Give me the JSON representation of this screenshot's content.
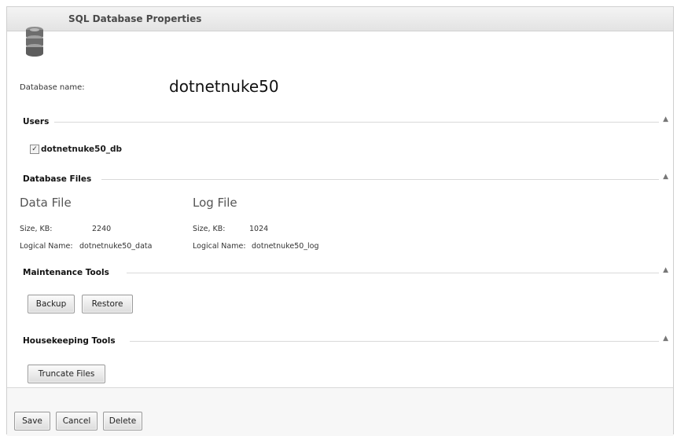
{
  "window": {
    "title": "SQL Database Properties"
  },
  "database": {
    "name_label": "Database name:",
    "name_value": "dotnetnuke50"
  },
  "users": {
    "section_title": "Users",
    "items": [
      {
        "name": "dotnetnuke50_db",
        "checked": true
      }
    ]
  },
  "files": {
    "section_title": "Database Files",
    "data_file": {
      "heading": "Data File",
      "size_label": "Size, KB:",
      "size_value": "2240",
      "logical_label": "Logical Name:",
      "logical_value": "dotnetnuke50_data"
    },
    "log_file": {
      "heading": "Log File",
      "size_label": "Size, KB:",
      "size_value": "1024",
      "logical_label": "Logical Name:",
      "logical_value": "dotnetnuke50_log"
    }
  },
  "maintenance": {
    "section_title": "Maintenance Tools",
    "backup_label": "Backup",
    "restore_label": "Restore"
  },
  "housekeeping": {
    "section_title": "Housekeeping Tools",
    "truncate_label": "Truncate Files"
  },
  "footer": {
    "save_label": "Save",
    "cancel_label": "Cancel",
    "delete_label": "Delete"
  },
  "icons": {
    "collapse": "chevron-up-icon",
    "database": "database-icon"
  }
}
